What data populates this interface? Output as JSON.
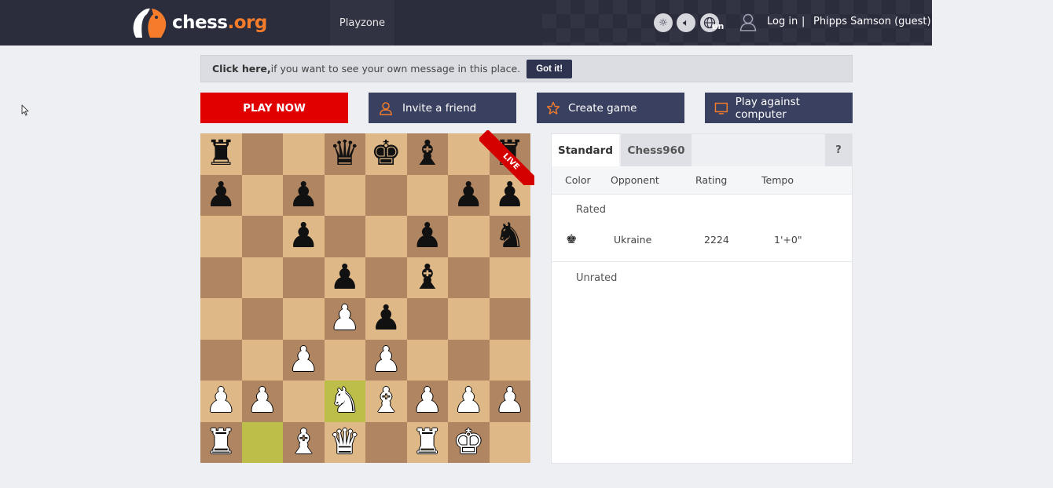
{
  "header": {
    "logo_main": "chess",
    "logo_tld": ".org",
    "nav_playzone": "Playzone",
    "icons": [
      "sun-icon",
      "volume-icon",
      "globe-icon"
    ],
    "language": "en",
    "login": "Log in",
    "separator": "|",
    "username": "Phipps Samson (guest)"
  },
  "message_bar": {
    "bold": "Click here,",
    "text": " if you want to see your own message in this place.",
    "button": "Got it!"
  },
  "actions": {
    "play_now": "PLAY NOW",
    "invite": "Invite a friend",
    "create": "Create game",
    "computer": "Play against computer"
  },
  "board": {
    "ribbon": "LIVE",
    "highlight_squares": [
      "d2",
      "b1"
    ],
    "ranks": [
      [
        "br",
        "",
        "",
        "bq",
        "bk",
        "bb",
        "",
        "br"
      ],
      [
        "bp",
        "",
        "bp",
        "",
        "",
        "",
        "bp",
        "bp"
      ],
      [
        "",
        "",
        "bp",
        "",
        "",
        "bp",
        "",
        "bn"
      ],
      [
        "",
        "",
        "",
        "bp",
        "",
        "bb",
        "",
        ""
      ],
      [
        "",
        "",
        "",
        "wp",
        "bp",
        "",
        "",
        ""
      ],
      [
        "",
        "",
        "wp",
        "",
        "wp",
        "",
        "",
        ""
      ],
      [
        "wp",
        "wp",
        "",
        "wn",
        "wb",
        "wp",
        "wp",
        "wp"
      ],
      [
        "wr",
        "",
        "wb",
        "wq",
        "",
        "wr",
        "wk",
        ""
      ]
    ]
  },
  "panel": {
    "tabs": [
      "Standard",
      "Chess960"
    ],
    "help": "?",
    "columns": [
      "Color",
      "Opponent",
      "Rating",
      "Tempo"
    ],
    "rated_label": "Rated",
    "unrated_label": "Unrated",
    "games": [
      {
        "color": "black",
        "opponent": "Ukraine",
        "rating": "2224",
        "tempo": "1'+0\""
      }
    ]
  },
  "colors": {
    "header_bg": "#2b2d3d",
    "accent_orange": "#f47c2a",
    "play_red": "#e00000",
    "button_dark": "#3a4060",
    "board_light": "#deb887",
    "board_dark": "#b08562",
    "highlight": "#bdbd4a"
  }
}
